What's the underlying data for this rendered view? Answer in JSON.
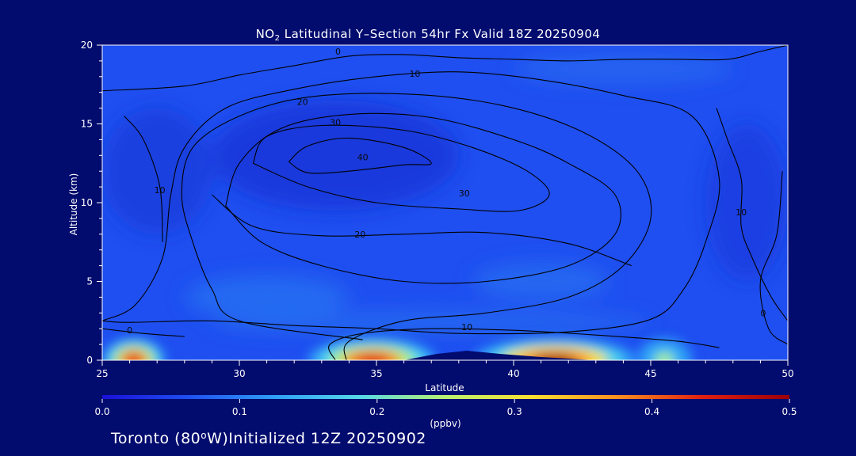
{
  "header": {
    "title_prefix": "NO",
    "title_sub": "2",
    "title_rest": " Latitudinal Y–Section 54hr  Fx Valid 18Z 20250904"
  },
  "footer": {
    "text_before_deg": "Toronto (80",
    "deg": "o",
    "text_after_deg": "W)Initialized 12Z 20250902"
  },
  "chart_data": {
    "type": "heatmap",
    "xlabel": "Latitude",
    "ylabel": "Altitude (km)",
    "xlim": [
      25,
      50
    ],
    "ylim": [
      0,
      20
    ],
    "x_ticks": [
      25,
      30,
      35,
      40,
      45,
      50
    ],
    "y_ticks": [
      0,
      5,
      10,
      15,
      20
    ],
    "grid": false,
    "colorbar": {
      "ticks": [
        0.0,
        0.1,
        0.2,
        0.3,
        0.4,
        0.5
      ],
      "tick_labels": [
        "0.0",
        "0.1",
        "0.2",
        "0.3",
        "0.4",
        "0.5"
      ],
      "unit": "(ppbv)",
      "colors": [
        "#1a10d8",
        "#1f4ff0",
        "#2f9ef6",
        "#55d8e8",
        "#b8f070",
        "#f8e030",
        "#f89020",
        "#e02010",
        "#9a0008"
      ]
    },
    "background_color": "#020b6e",
    "field_color": "#1f4ff0",
    "surface_hotspots": [
      {
        "lat_min": 25.0,
        "lat_max": 27.3,
        "peak": 0.45
      },
      {
        "lat_min": 32.5,
        "lat_max": 37.2,
        "peak": 0.45
      },
      {
        "lat_min": 38.5,
        "lat_max": 44.5,
        "peak": 0.5
      },
      {
        "lat_min": 44.5,
        "lat_max": 46.5,
        "peak": 0.25
      }
    ],
    "terrain": [
      [
        36.0,
        0.0
      ],
      [
        37.2,
        0.4
      ],
      [
        38.3,
        0.6
      ],
      [
        39.5,
        0.4
      ],
      [
        41.0,
        0.2
      ],
      [
        43.0,
        0.0
      ]
    ],
    "contours": [
      {
        "label": "0",
        "label_at": [
          33.6,
          19.6
        ],
        "points": [
          [
            25,
            17.1
          ],
          [
            28,
            17.4
          ],
          [
            30,
            18.1
          ],
          [
            32,
            18.7
          ],
          [
            34,
            19.3
          ],
          [
            36,
            19.4
          ],
          [
            38,
            19.2
          ],
          [
            40,
            19.1
          ],
          [
            42,
            19.0
          ],
          [
            44,
            19.1
          ],
          [
            46,
            19.1
          ],
          [
            47.8,
            19.1
          ],
          [
            49,
            19.6
          ],
          [
            50,
            20.0
          ]
        ]
      },
      {
        "label": "10",
        "label_at": [
          36.4,
          18.2
        ],
        "points": [
          [
            25,
            2.5
          ],
          [
            26.2,
            3.5
          ],
          [
            27.2,
            6.5
          ],
          [
            27.5,
            10.5
          ],
          [
            28,
            13.5
          ],
          [
            29.5,
            16.0
          ],
          [
            32,
            17.2
          ],
          [
            35,
            18.0
          ],
          [
            38,
            18.3
          ],
          [
            41,
            17.8
          ],
          [
            44,
            16.8
          ],
          [
            46.5,
            15.5
          ],
          [
            47.5,
            11.5
          ],
          [
            47,
            7.5
          ],
          [
            46.2,
            4.5
          ],
          [
            45,
            2.6
          ],
          [
            42,
            1.8
          ],
          [
            38,
            1.7
          ],
          [
            35,
            2.0
          ],
          [
            32,
            2.2
          ],
          [
            29,
            2.5
          ],
          [
            26,
            2.4
          ],
          [
            25,
            2.5
          ]
        ]
      },
      {
        "label": "20",
        "label_at": [
          32.3,
          16.4
        ],
        "points": [
          [
            34.5,
            1.3
          ],
          [
            30,
            2.5
          ],
          [
            29,
            4.5
          ],
          [
            28.3,
            7.5
          ],
          [
            27.9,
            10.5
          ],
          [
            28.3,
            13.5
          ],
          [
            30,
            15.5
          ],
          [
            32.5,
            16.7
          ],
          [
            36,
            16.9
          ],
          [
            39.5,
            16.2
          ],
          [
            42.5,
            14.5
          ],
          [
            44.5,
            12.0
          ],
          [
            45,
            9.0
          ],
          [
            44,
            6.0
          ],
          [
            42,
            4.0
          ],
          [
            39,
            3.0
          ],
          [
            36,
            2.5
          ],
          [
            34,
            1.2
          ],
          [
            33.9,
            0.0
          ]
        ]
      },
      {
        "label": "30",
        "label_at": [
          33.5,
          15.1
        ],
        "points": [
          [
            29.5,
            9.8
          ],
          [
            30,
            12.5
          ],
          [
            31.5,
            14.7
          ],
          [
            34,
            15.6
          ],
          [
            37,
            15.4
          ],
          [
            40,
            14.0
          ],
          [
            42,
            12.5
          ],
          [
            43.7,
            10.5
          ],
          [
            43.7,
            8.0
          ],
          [
            42,
            6.0
          ],
          [
            39,
            5.0
          ],
          [
            36,
            5.0
          ],
          [
            33,
            6.0
          ],
          [
            30.8,
            7.5
          ],
          [
            29.5,
            9.8
          ]
        ]
      },
      {
        "label": "30",
        "label_at": [
          38.2,
          10.6
        ],
        "points": [
          [
            30.5,
            12.5
          ],
          [
            31,
            14.2
          ],
          [
            33,
            14.9
          ],
          [
            36,
            14.6
          ],
          [
            38.5,
            13.5
          ],
          [
            40.5,
            12.0
          ],
          [
            41.3,
            10.5
          ],
          [
            40.2,
            9.5
          ],
          [
            38,
            9.6
          ],
          [
            35,
            10.0
          ],
          [
            32.5,
            11.0
          ],
          [
            30.5,
            12.5
          ]
        ]
      },
      {
        "label": "40",
        "label_at": [
          34.5,
          12.9
        ],
        "points": [
          [
            31.8,
            12.6
          ],
          [
            32.5,
            13.6
          ],
          [
            34,
            14.1
          ],
          [
            36,
            13.5
          ],
          [
            37,
            12.5
          ],
          [
            36,
            12.4
          ],
          [
            34,
            12.0
          ],
          [
            32.5,
            11.9
          ],
          [
            31.8,
            12.6
          ]
        ]
      },
      {
        "label": "20",
        "label_at": [
          34.4,
          8.0
        ],
        "points": [
          [
            29,
            10.5
          ],
          [
            30.5,
            8.5
          ],
          [
            33,
            7.9
          ],
          [
            36,
            8.0
          ],
          [
            39,
            8.1
          ],
          [
            42,
            7.4
          ],
          [
            44.3,
            6.0
          ]
        ]
      },
      {
        "label": "10",
        "label_at": [
          48.3,
          9.4
        ],
        "points": [
          [
            47.4,
            16.0
          ],
          [
            47.8,
            14.0
          ],
          [
            48.3,
            11.5
          ],
          [
            48.3,
            8.5
          ],
          [
            48.7,
            6.5
          ],
          [
            49.4,
            4.0
          ],
          [
            50,
            2.5
          ]
        ]
      },
      {
        "label": "10",
        "label_at": [
          27.1,
          10.8
        ],
        "points": [
          [
            25.8,
            15.5
          ],
          [
            26.5,
            14.0
          ],
          [
            27.1,
            11.0
          ],
          [
            27.2,
            7.5
          ]
        ]
      },
      {
        "label": "10",
        "label_at": [
          38.3,
          2.1
        ],
        "points": [
          [
            33.5,
            0.0
          ],
          [
            33.3,
            1.0
          ],
          [
            34.5,
            1.7
          ],
          [
            37,
            2.0
          ],
          [
            40,
            1.9
          ],
          [
            43,
            1.6
          ],
          [
            46,
            1.2
          ],
          [
            47.5,
            0.8
          ]
        ]
      },
      {
        "label": "0",
        "label_at": [
          49.1,
          3.0
        ],
        "points": [
          [
            49.8,
            12.0
          ],
          [
            49.6,
            8.0
          ],
          [
            49.0,
            5.0
          ],
          [
            49.3,
            2.0
          ],
          [
            50,
            1.0
          ]
        ]
      },
      {
        "label": "0",
        "label_at": [
          26.0,
          1.9
        ],
        "points": [
          [
            25,
            2.0
          ],
          [
            26.5,
            1.7
          ],
          [
            28,
            1.5
          ]
        ]
      }
    ]
  }
}
